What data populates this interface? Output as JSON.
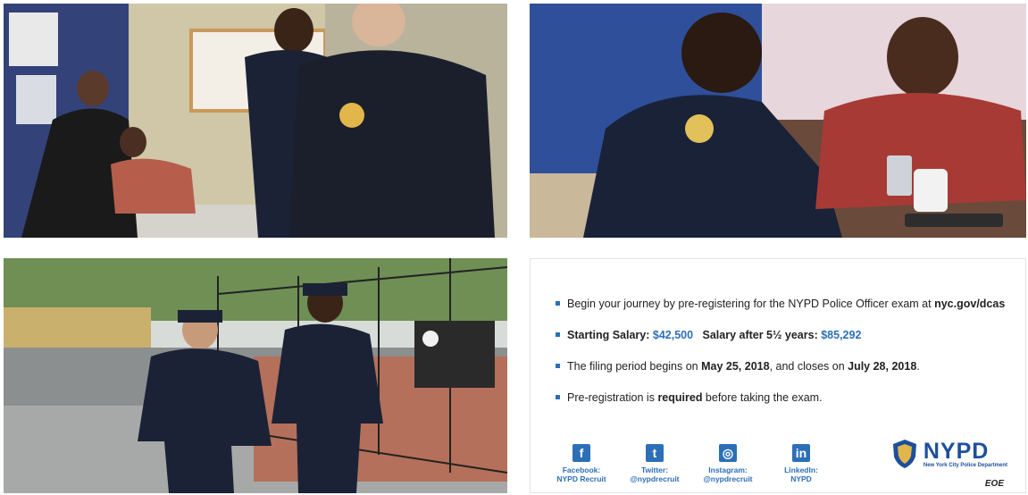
{
  "photos": {
    "top_left": "community-meeting-photo",
    "top_right": "officer-with-resident-photo",
    "bottom_left": "officers-on-patrol-photo"
  },
  "info": {
    "items": [
      {
        "text_a": "Begin your journey by pre-registering for the NYPD Police Officer exam at ",
        "text_b": "nyc.gov/dcas"
      },
      {
        "label_a": "Starting Salary: ",
        "value_a": "$42,500",
        "label_b": "Salary after 5½ years: ",
        "value_b": "$85,292"
      },
      {
        "text_a": "The filing period begins on ",
        "date_a": "May 25, 2018",
        "text_b": ", and closes on ",
        "date_b": "July 28, 2018",
        "text_c": "."
      },
      {
        "text_a": "Pre-registration is ",
        "emphasis": "required",
        "text_b": " before taking the exam."
      }
    ]
  },
  "socials": [
    {
      "icon": "facebook-icon",
      "glyph": "f",
      "line1": "Facebook:",
      "line2": "NYPD Recruit"
    },
    {
      "icon": "twitter-icon",
      "glyph": "t",
      "line1": "Twitter:",
      "line2": "@nypdrecruit"
    },
    {
      "icon": "instagram-icon",
      "glyph": "◎",
      "line1": "Instagram:",
      "line2": "@nypdrecruit"
    },
    {
      "icon": "linkedin-icon",
      "glyph": "in",
      "line1": "LinkedIn:",
      "line2": "NYPD"
    }
  ],
  "logo": {
    "title": "NYPD",
    "subtitle": "New York City Police Department"
  },
  "footer": {
    "eoe": "EOE"
  },
  "colors": {
    "accent": "#2c6fb7",
    "brand": "#1d4f9c",
    "uniform": "#1b2236"
  }
}
